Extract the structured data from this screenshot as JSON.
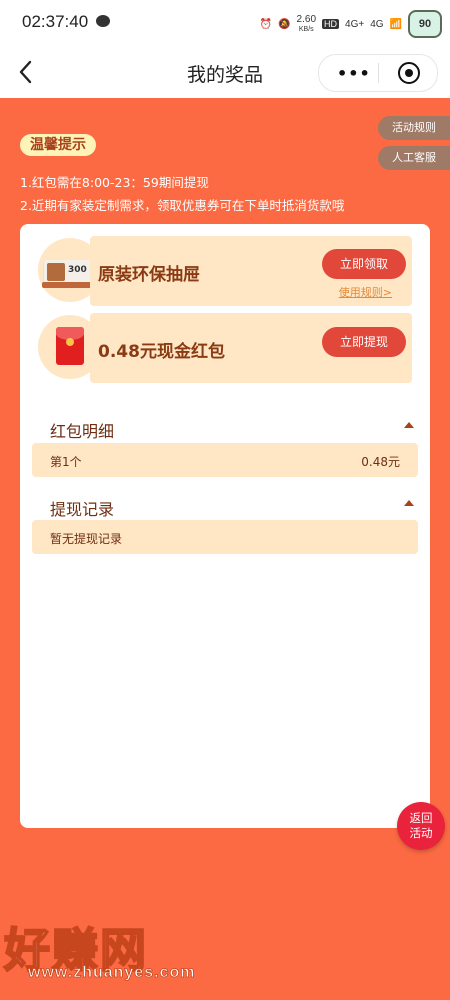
{
  "status_bar": {
    "time": "02:37:40",
    "net_speed_value": "2.60",
    "net_speed_unit": "KB/s",
    "hd": "HD",
    "signal_1": "4G+",
    "signal_2": "4G",
    "battery": "90"
  },
  "nav": {
    "title": "我的奖品",
    "more_icon": "•••"
  },
  "side_buttons": {
    "rules": "活动规则",
    "service": "人工客服"
  },
  "tips": {
    "badge": "温馨提示",
    "line1": "1.红包需在8:00-23：59期间提现",
    "line2": "2.近期有家装定制需求，领取优惠券可在下单时抵消货款哦"
  },
  "prizes": [
    {
      "title": "原装环保抽屉",
      "button": "立即领取",
      "link": "使用规则>",
      "thumb_text": "300"
    },
    {
      "title": "0.48元现金红包",
      "button": "立即提现"
    }
  ],
  "sections": {
    "redpacket": {
      "title": "红包明细",
      "rows": [
        {
          "label": "第1个",
          "amount": "0.48元"
        }
      ]
    },
    "withdraw": {
      "title": "提现记录",
      "empty": "暂无提现记录"
    }
  },
  "return_button": {
    "line1": "返回",
    "line2": "活动"
  },
  "watermark": {
    "text": "好赚网",
    "url": "www.zhuanyes.com"
  }
}
